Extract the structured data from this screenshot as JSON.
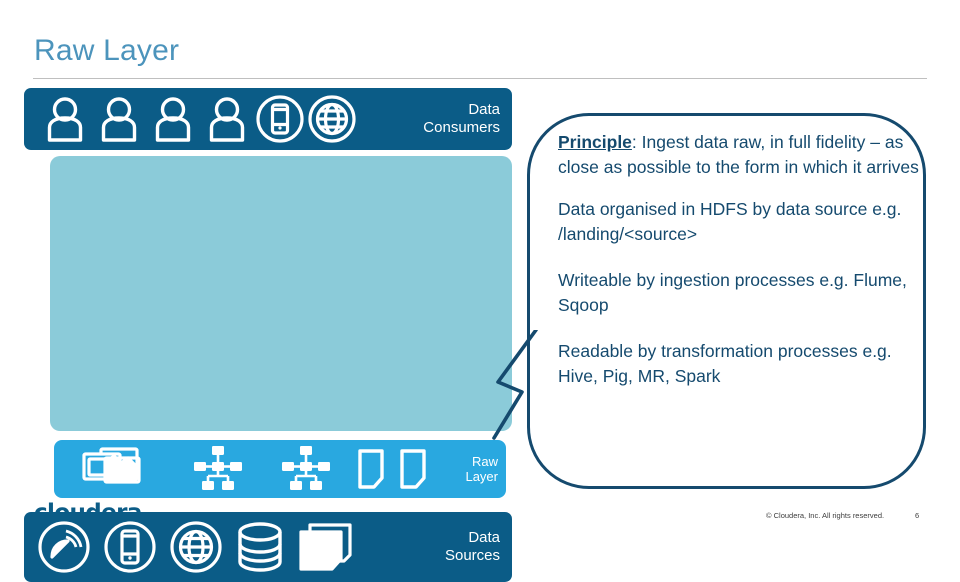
{
  "slide": {
    "title": "Raw Layer",
    "accent_title_color": "#4C94BC",
    "dark_band_color": "#0B5C87",
    "mid_band_color": "#29A8E0",
    "teal_box_color": "#8BCBD9",
    "callout_border_color": "#154A6E"
  },
  "diagram": {
    "consumers_band": {
      "label": "Data\nConsumers",
      "icons": [
        "person-icon",
        "person-icon",
        "person-icon",
        "person-icon",
        "mobile-phone-circle-icon",
        "globe-circle-icon"
      ]
    },
    "raw_layer_band": {
      "label": "Raw\nLayer",
      "icons": [
        "stacked-documents-icon",
        "cluster-nodes-icon",
        "cluster-nodes-icon",
        "file-icon",
        "file-icon"
      ]
    },
    "sources_band": {
      "label": "Data\nSources",
      "icons": [
        "satellite-dish-circle-icon",
        "mobile-phone-circle-icon",
        "globe-circle-icon",
        "database-cylinder-icon",
        "document-page-icon"
      ]
    }
  },
  "callout": {
    "principle_label": "Principle",
    "principle_text": ": Ingest data raw, in full fidelity – as close as possible to the form in which it arrives",
    "paragraph_2": "Data organised in HDFS by data source e.g. /landing/<source>",
    "paragraph_3": "Writeable by ingestion processes e.g. Flume, Sqoop",
    "paragraph_4": "Readable by transformation processes e.g. Hive, Pig, MR, Spark"
  },
  "footer": {
    "logo": "cloudera",
    "copyright": "© Cloudera, Inc. All rights reserved.",
    "page_number": "6"
  }
}
